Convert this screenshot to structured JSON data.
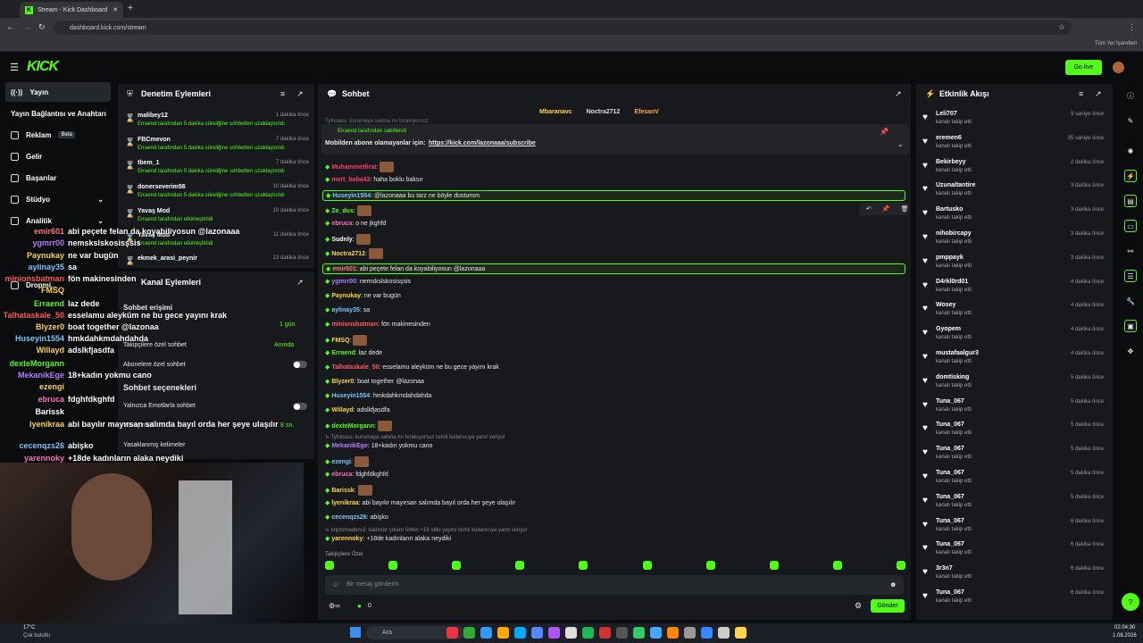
{
  "browser": {
    "tab_title": "Stream - Kick Dashboard",
    "url": "dashboard.kick.com/stream",
    "bookmarks_label": "Tüm Yer İşaretleri"
  },
  "header": {
    "logo": "KICK",
    "golive": "Go live"
  },
  "sidebar": {
    "items": [
      {
        "label": "Yayın",
        "active": true
      },
      {
        "label": "Yayın Bağlantısı ve Anahtarı"
      },
      {
        "label": "Reklam",
        "badge": "Beta"
      },
      {
        "label": "Gelir"
      },
      {
        "label": "Başarılar"
      },
      {
        "label": "Stüdyo"
      },
      {
        "label": "Analitik"
      },
      {
        "label": "Dropmi..."
      }
    ]
  },
  "mod": {
    "title": "Denetim Eylemleri",
    "rows": [
      {
        "name": "malibey12",
        "sub": "Erraend tarafından 5 dakika süreliğine sohbetten uzaklaştırıldı",
        "time": "1 dakika önce"
      },
      {
        "name": "FBCmevon",
        "sub": "Erraend tarafından 5 dakika süreliğine sohbetten uzaklaştırıldı",
        "time": "7 dakika önce"
      },
      {
        "name": "tbem_1",
        "sub": "Erraend tarafından 5 dakika süreliğine sohbetten uzaklaştırıldı",
        "time": "7 dakika önce"
      },
      {
        "name": "donerseverim56",
        "sub": "Erraend tarafından 5 dakika süreliğine sohbetten uzaklaştırıldı",
        "time": "10 dakika önce"
      },
      {
        "name": "Yavaş Mod",
        "sub": "Erraend tarafından etkinleştirildi",
        "time": "10 dakika önce"
      },
      {
        "name": "Yavaş Mod",
        "sub": "Erraend tarafından etkinleştirildi",
        "time": "11 dakika önce"
      },
      {
        "name": "ekmek_arasi_peynir",
        "sub": "",
        "time": "13 dakika önce"
      }
    ]
  },
  "channel": {
    "title": "Kanal Eylemleri",
    "chat_access": "Sohbet erişimi",
    "followers_chat": "Takipçilere özel sohbet",
    "followers_value": "Anında",
    "oneday": "1 gün",
    "subs_chat": "Abonelere özel sohbet",
    "chat_options": "Sohbet seçenekleri",
    "emotes_only": "Yalnızca Emotlarla sohbet",
    "slow": "Yavaş mod",
    "slow_value": "8 sn.",
    "banned_words": "Yasaklanmış kelimeler"
  },
  "overlay": [
    {
      "name": "emir601",
      "text": "abi peçete felan da koyabiliyosun @lazonaaa",
      "color": "#ff7a7a"
    },
    {
      "name": "ygmrr00",
      "text": "nemskslskosisşsis",
      "color": "#b77cff"
    },
    {
      "name": "Paynukay",
      "text": "ne var bugün",
      "color": "#ffd54a"
    },
    {
      "name": "aylinay35",
      "text": "sa",
      "color": "#7cc7ff"
    },
    {
      "name": "minionsbatman",
      "text": "fön makinesinden",
      "color": "#ff5a5a"
    },
    {
      "name": "FMSQ",
      "text": "",
      "color": "#ffd54a"
    },
    {
      "name": "Erraend",
      "text": "laz dede",
      "color": "#53fc18"
    },
    {
      "name": "Talhataskale_50",
      "text": "esselamu aleyküm ne bu gece yayını krak",
      "color": "#ff5a5a"
    },
    {
      "name": "Blyzer0",
      "text": "boat together @lazonaa",
      "color": "#ffd54a"
    },
    {
      "name": "Huseyin1554",
      "text": "hmkdahkmdahdahda",
      "color": "#7cc7ff"
    },
    {
      "name": "Willayd",
      "text": "adslkfjasdfa",
      "color": "#ffd54a"
    },
    {
      "name": "dexteMorgann",
      "text": "",
      "color": "#53fc18"
    },
    {
      "name": "MekanikEge",
      "text": "18+kadın yokmu cano",
      "color": "#b77cff"
    },
    {
      "name": "ezengi",
      "text": "",
      "color": "#ffd54a"
    },
    {
      "name": "ebruca",
      "text": "fdghfdkghfd",
      "color": "#ff6fc1"
    },
    {
      "name": "Barissk",
      "text": "",
      "color": "#ffffff"
    },
    {
      "name": "lyenikraa",
      "text": "abi bayılır mayırsan salımda bayıl orda her şeye ulaşılır",
      "color": "#ffd54a"
    },
    {
      "name": "cecenqzs26",
      "text": "abişko",
      "color": "#7cc7ff"
    },
    {
      "name": "yarennoky",
      "text": "+18de kadınların alaka neydiki",
      "color": "#ff6fc1"
    }
  ],
  "chat": {
    "title": "Sohbet",
    "top": [
      "Mbaranavc",
      "Noctra2712",
      "EfesanV"
    ],
    "pinned_by": "Erraend tarafından sabitlendi",
    "pinned_text": "Mobilden abone olamayanlar için:",
    "pinned_link": "https://kick.com/lazonaaa/subscribe",
    "faded_top": "Tyfonass: kurumaya salona mı bırakıyorsuz",
    "messages": [
      {
        "name": "Muhammetfirat",
        "text": "",
        "color": "#ff3b6b"
      },
      {
        "name": "mert_baba43",
        "text": "haha boklu baksır",
        "color": "#ff3b6b"
      },
      {
        "name": "Huseyin1554",
        "text": "@lazonaaa bu tarz ne böyle dostumm",
        "color": "#7cc7ff"
      },
      {
        "name": "Ze_dus",
        "text": "",
        "color": "#53fc18"
      },
      {
        "name": "ebruca",
        "text": "o ne jkghfd",
        "color": "#ff6fc1"
      },
      {
        "name": "Sudnly",
        "text": "",
        "color": "#ffffff"
      },
      {
        "name": "Noctra2712",
        "text": "",
        "color": "#ffd54a"
      },
      {
        "name": "emir601",
        "text": "abi peçete felan da koyabiliyosun @lazonaaa",
        "color": "#ff7a7a"
      },
      {
        "name": "ygmrr00",
        "text": "nemskslskosisşsis",
        "color": "#b77cff"
      },
      {
        "name": "Paynukay",
        "text": "ne var bugün",
        "color": "#ffd54a"
      },
      {
        "name": "aylinay35",
        "text": "sa",
        "color": "#7cc7ff"
      },
      {
        "name": "minionsbatman",
        "text": "fön makinesinden",
        "color": "#ff5a5a"
      },
      {
        "name": "FMSQ",
        "text": "",
        "color": "#ffd54a"
      },
      {
        "name": "Erraend",
        "text": "laz dede",
        "color": "#53fc18"
      },
      {
        "name": "Talhataskale_50",
        "text": "esselamu aleyküm ne bu gece yayını krak",
        "color": "#ff5a5a"
      },
      {
        "name": "Blyzer0",
        "text": "boat together @lazonaa",
        "color": "#ffd54a"
      },
      {
        "name": "Huseyin1554",
        "text": "hmkdahkmdahdahda",
        "color": "#7cc7ff"
      },
      {
        "name": "Willayd",
        "text": "adslkfjasdfa",
        "color": "#ffd54a"
      },
      {
        "name": "dexteMorgann",
        "text": "",
        "color": "#53fc18"
      },
      {
        "name": "reply",
        "text": "Tyfonass: kurumaya salona mı bırakıyorsuz isimli kullanıcıya yanıt veriyor",
        "color": "#888888"
      },
      {
        "name": "MekanikEge",
        "text": "18+kadın yokmu cano",
        "color": "#b77cff"
      },
      {
        "name": "ezengi",
        "text": "",
        "color": "#7cc7ff"
      },
      {
        "name": "ebruca",
        "text": "fdghfdkghfd",
        "color": "#ff6fc1"
      },
      {
        "name": "Barissk",
        "text": "",
        "color": "#ffd54a"
      },
      {
        "name": "lyenikraa",
        "text": "abi bayılır mayırsan salımda bayıl orda her şeye ulaşılır",
        "color": "#ffd54a"
      },
      {
        "name": "cecenqzs26",
        "text": "abişko",
        "color": "#7cc7ff"
      },
      {
        "name": "reply",
        "text": "kriptomadencii: kadınlar çıkarır lütfen +18 oldu yayını isimli kullanıcıya yanıt veriyor",
        "color": "#888888"
      },
      {
        "name": "yarennoky",
        "text": "+18de kadınların alaka neydiki",
        "color": "#ffd54a"
      }
    ],
    "followers_only": "Takipçilere Özel",
    "input_placeholder": "Bir mesaj gönderin",
    "send": "Gönder",
    "count": "0"
  },
  "events": {
    "title": "Etkinlik Akışı",
    "items": [
      {
        "name": "Leli707",
        "sub": "kanalı takip etti",
        "time": "9 saniye önce"
      },
      {
        "name": "eremen6",
        "sub": "kanalı takip etti",
        "time": "35 saniye önce"
      },
      {
        "name": "Bekirbeyy",
        "sub": "kanalı takip etti",
        "time": "2 dakika önce"
      },
      {
        "name": "Uzunaltantire",
        "sub": "kanalı takip etti",
        "time": "3 dakika önce"
      },
      {
        "name": "Bartusko",
        "sub": "kanalı takip etti",
        "time": "3 dakika önce"
      },
      {
        "name": "nihobircapy",
        "sub": "kanalı takip etti",
        "time": "3 dakika önce"
      },
      {
        "name": "pmppayk",
        "sub": "kanalı takip etti",
        "time": "3 dakika önce"
      },
      {
        "name": "D4rkl0rd01",
        "sub": "kanalı takip etti",
        "time": "4 dakika önce"
      },
      {
        "name": "Wosey",
        "sub": "kanalı takip etti",
        "time": "4 dakika önce"
      },
      {
        "name": "Gyopem",
        "sub": "kanalı takip etti",
        "time": "4 dakika önce"
      },
      {
        "name": "mustafaalgur3",
        "sub": "kanalı takip etti",
        "time": "4 dakika önce"
      },
      {
        "name": "domtisking",
        "sub": "kanalı takip etti",
        "time": "5 dakika önce"
      },
      {
        "name": "Tuna_067",
        "sub": "kanalı takip etti",
        "time": "5 dakika önce"
      },
      {
        "name": "Tuna_067",
        "sub": "kanalı takip etti",
        "time": "5 dakika önce"
      },
      {
        "name": "Tuna_067",
        "sub": "kanalı takip etti",
        "time": "5 dakika önce"
      },
      {
        "name": "Tuna_067",
        "sub": "kanalı takip etti",
        "time": "5 dakika önce"
      },
      {
        "name": "Tuna_067",
        "sub": "kanalı takip etti",
        "time": "5 dakika önce"
      },
      {
        "name": "Tuna_067",
        "sub": "kanalı takip etti",
        "time": "6 dakika önce"
      },
      {
        "name": "Tuna_067",
        "sub": "kanalı takip etti",
        "time": "6 dakika önce"
      },
      {
        "name": "3r3n7",
        "sub": "kanalı takip etti",
        "time": "6 dakika önce"
      },
      {
        "name": "Tuna_067",
        "sub": "kanalı takip etti",
        "time": "6 dakika önce"
      }
    ]
  },
  "taskbar": {
    "weather_temp": "17°C",
    "weather_desc": "Çok bulutlu",
    "search": "Ara",
    "time": "02:04:30",
    "date": "1.08.2026"
  },
  "colors": {
    "accent": "#53fc18"
  }
}
